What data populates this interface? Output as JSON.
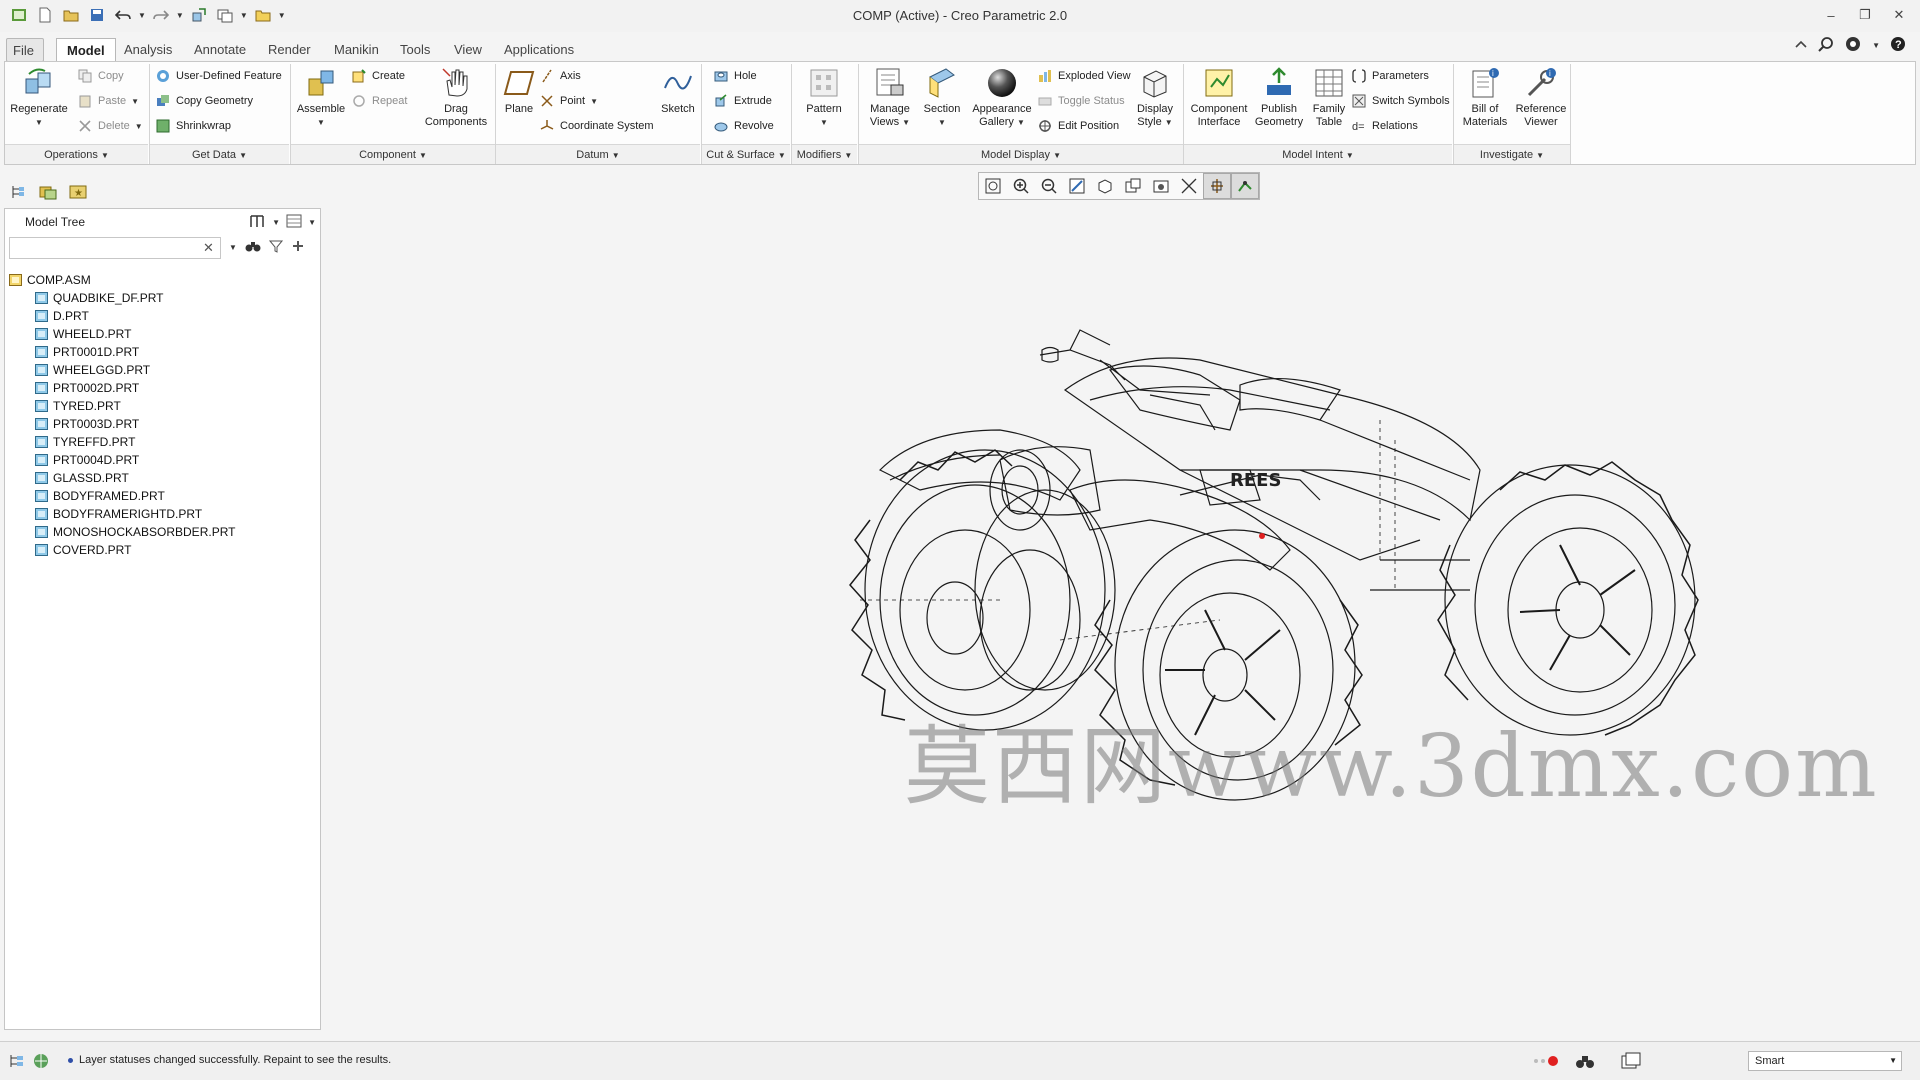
{
  "window": {
    "title": "COMP (Active) - Creo Parametric 2.0"
  },
  "tabs": [
    "File",
    "Model",
    "Analysis",
    "Annotate",
    "Render",
    "Manikin",
    "Tools",
    "View",
    "Applications"
  ],
  "ribbon": {
    "operations": {
      "regenerate": "Regenerate",
      "copy": "Copy",
      "paste": "Paste",
      "delete": "Delete",
      "group": "Operations"
    },
    "get_data": {
      "udf": "User-Defined Feature",
      "copy_geometry": "Copy Geometry",
      "shrinkwrap": "Shrinkwrap",
      "group": "Get Data"
    },
    "component": {
      "assemble": "Assemble",
      "create": "Create",
      "repeat": "Repeat",
      "drag_line1": "Drag",
      "drag_line2": "Components",
      "group": "Component"
    },
    "datum": {
      "plane": "Plane",
      "axis": "Axis",
      "point": "Point",
      "csys": "Coordinate System",
      "sketch": "Sketch",
      "group": "Datum"
    },
    "cut_surface": {
      "hole": "Hole",
      "extrude": "Extrude",
      "revolve": "Revolve",
      "group": "Cut & Surface"
    },
    "modifiers": {
      "pattern": "Pattern",
      "group": "Modifiers"
    },
    "model_display": {
      "manage_line1": "Manage",
      "manage_line2": "Views",
      "section": "Section",
      "appearance_line1": "Appearance",
      "appearance_line2": "Gallery",
      "exploded": "Exploded View",
      "toggle": "Toggle Status",
      "edit_position": "Edit Position",
      "display_line1": "Display",
      "display_line2": "Style",
      "group": "Model Display"
    },
    "model_intent": {
      "ci_line1": "Component",
      "ci_line2": "Interface",
      "pg_line1": "Publish",
      "pg_line2": "Geometry",
      "ft_line1": "Family",
      "ft_line2": "Table",
      "parameters": "Parameters",
      "switch_symbols": "Switch Symbols",
      "relations": "Relations",
      "group": "Model Intent"
    },
    "investigate": {
      "bom_line1": "Bill of",
      "bom_line2": "Materials",
      "rv_line1": "Reference",
      "rv_line2": "Viewer",
      "group": "Investigate"
    }
  },
  "model_tree": {
    "title": "Model Tree",
    "search_value": "",
    "root": "COMP.ASM",
    "items": [
      "QUADBIKE_DF.PRT",
      "D.PRT",
      "WHEELD.PRT",
      "PRT0001D.PRT",
      "WHEELGGD.PRT",
      "PRT0002D.PRT",
      "TYRED.PRT",
      "PRT0003D.PRT",
      "TYREFFD.PRT",
      "PRT0004D.PRT",
      "GLASSD.PRT",
      "BODYFRAMED.PRT",
      "BODYFRAMERIGHTD.PRT",
      "MONOSHOCKABSORBDER.PRT",
      "COVERD.PRT"
    ]
  },
  "viewport": {
    "watermark": "莫西网www.3dmx.com"
  },
  "status": {
    "message": "Layer statuses changed successfully. Repaint to see the results.",
    "filter": "Smart"
  }
}
